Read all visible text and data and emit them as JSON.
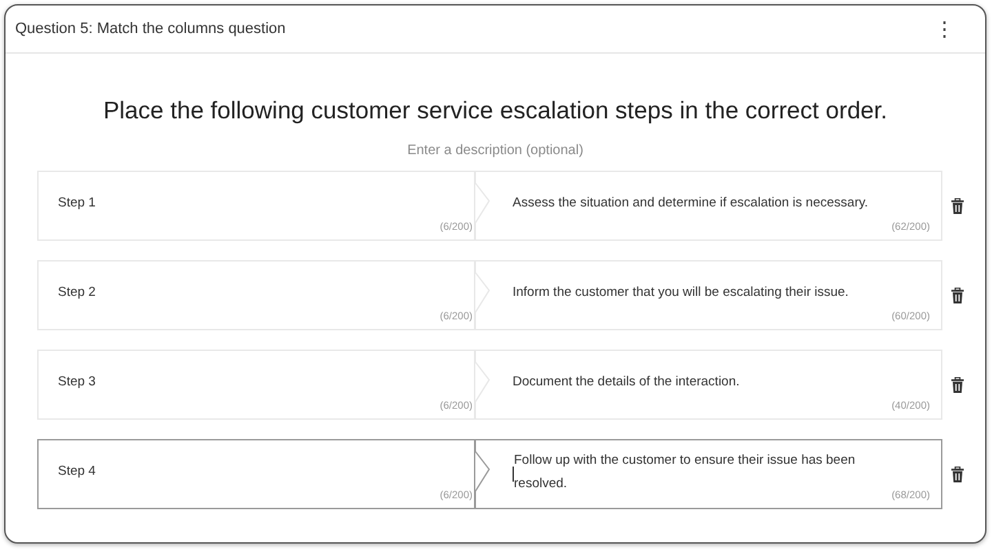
{
  "header": {
    "title": "Question 5: Match the columns question",
    "menu_icon": "⋮"
  },
  "question": "Place the following customer service escalation steps in the correct order.",
  "description": {
    "placeholder": "Enter a description (optional)"
  },
  "pairs": [
    {
      "left": {
        "value": "Step 1",
        "counter": "(6/200)"
      },
      "right": {
        "value": "Assess the situation and determine if escalation is necessary.",
        "counter": "(62/200)"
      },
      "focused": false
    },
    {
      "left": {
        "value": "Step 2",
        "counter": "(6/200)"
      },
      "right": {
        "value": "Inform the customer that you will be escalating their issue.",
        "counter": "(60/200)"
      },
      "focused": false
    },
    {
      "left": {
        "value": "Step 3",
        "counter": "(6/200)"
      },
      "right": {
        "value": "Document the details of the interaction.",
        "counter": "(40/200)"
      },
      "focused": false
    },
    {
      "left": {
        "value": "Step 4",
        "counter": "(6/200)"
      },
      "right": {
        "value": "Follow up with the customer to ensure their issue has been resolved.",
        "counter": "(68/200)"
      },
      "focused": true
    }
  ]
}
